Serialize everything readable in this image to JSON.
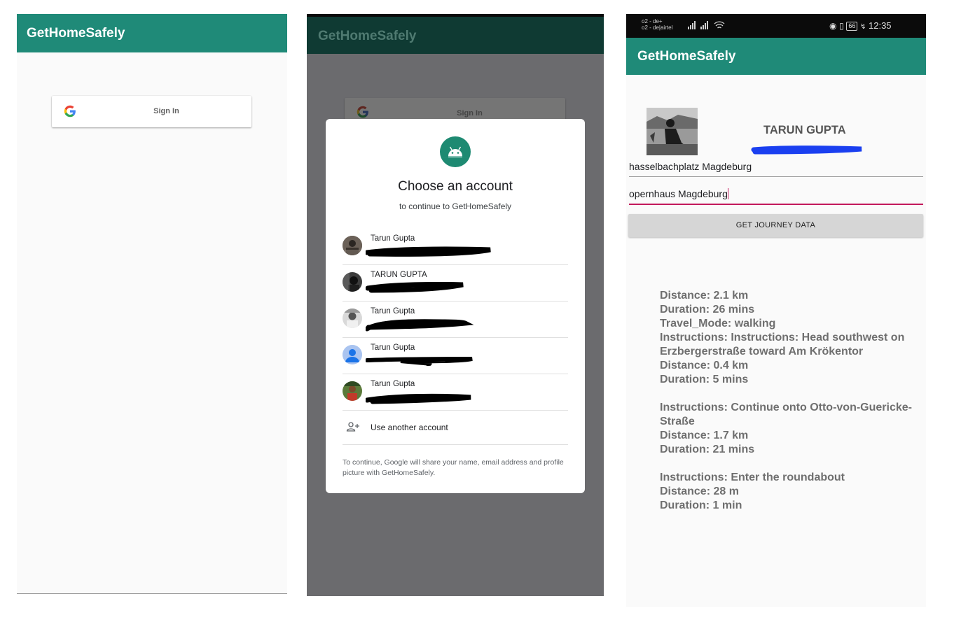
{
  "app_name": "GetHomeSafely",
  "screen1": {
    "sign_in_label": "Sign In"
  },
  "screen2": {
    "bg_sign_in_label": "Sign In",
    "dialog": {
      "title": "Choose an account",
      "subtitle": "to continue to GetHomeSafely",
      "accounts": [
        {
          "name": "Tarun Gupta"
        },
        {
          "name": "TARUN GUPTA"
        },
        {
          "name": "Tarun Gupta"
        },
        {
          "name": "Tarun Gupta"
        },
        {
          "name": "Tarun Gupta"
        }
      ],
      "use_another": "Use another account",
      "footer": "To continue, Google will share your name, email address and profile picture with GetHomeSafely."
    }
  },
  "screen3": {
    "status": {
      "carrier1": "o2 - de+",
      "carrier2": "o2 - de|airtel",
      "battery": "66",
      "time": "12:35"
    },
    "profile_name": "TARUN GUPTA",
    "from": "hasselbachplatz Magdeburg",
    "to": "opernhaus Magdeburg",
    "button": "GET JOURNEY DATA",
    "results": [
      "Distance: 2.1 km",
      "Duration: 26 mins",
      "Travel_Mode: walking",
      "Instructions: Instructions: Head southwest on Erzbergerstraße toward Am Krökentor",
      "Distance: 0.4 km",
      "Duration: 5 mins",
      "",
      "Instructions: Continue onto Otto-von-Guericke-Straße",
      "Distance: 1.7 km",
      "Duration: 21 mins",
      "",
      "Instructions: Enter the roundabout",
      "Distance: 28 m",
      "Duration: 1 min"
    ]
  },
  "colors": {
    "primary": "#1f8a78",
    "scrim": "#6b6b6e",
    "accent": "#c2185b",
    "redaction_blue": "#1a3ff0"
  }
}
